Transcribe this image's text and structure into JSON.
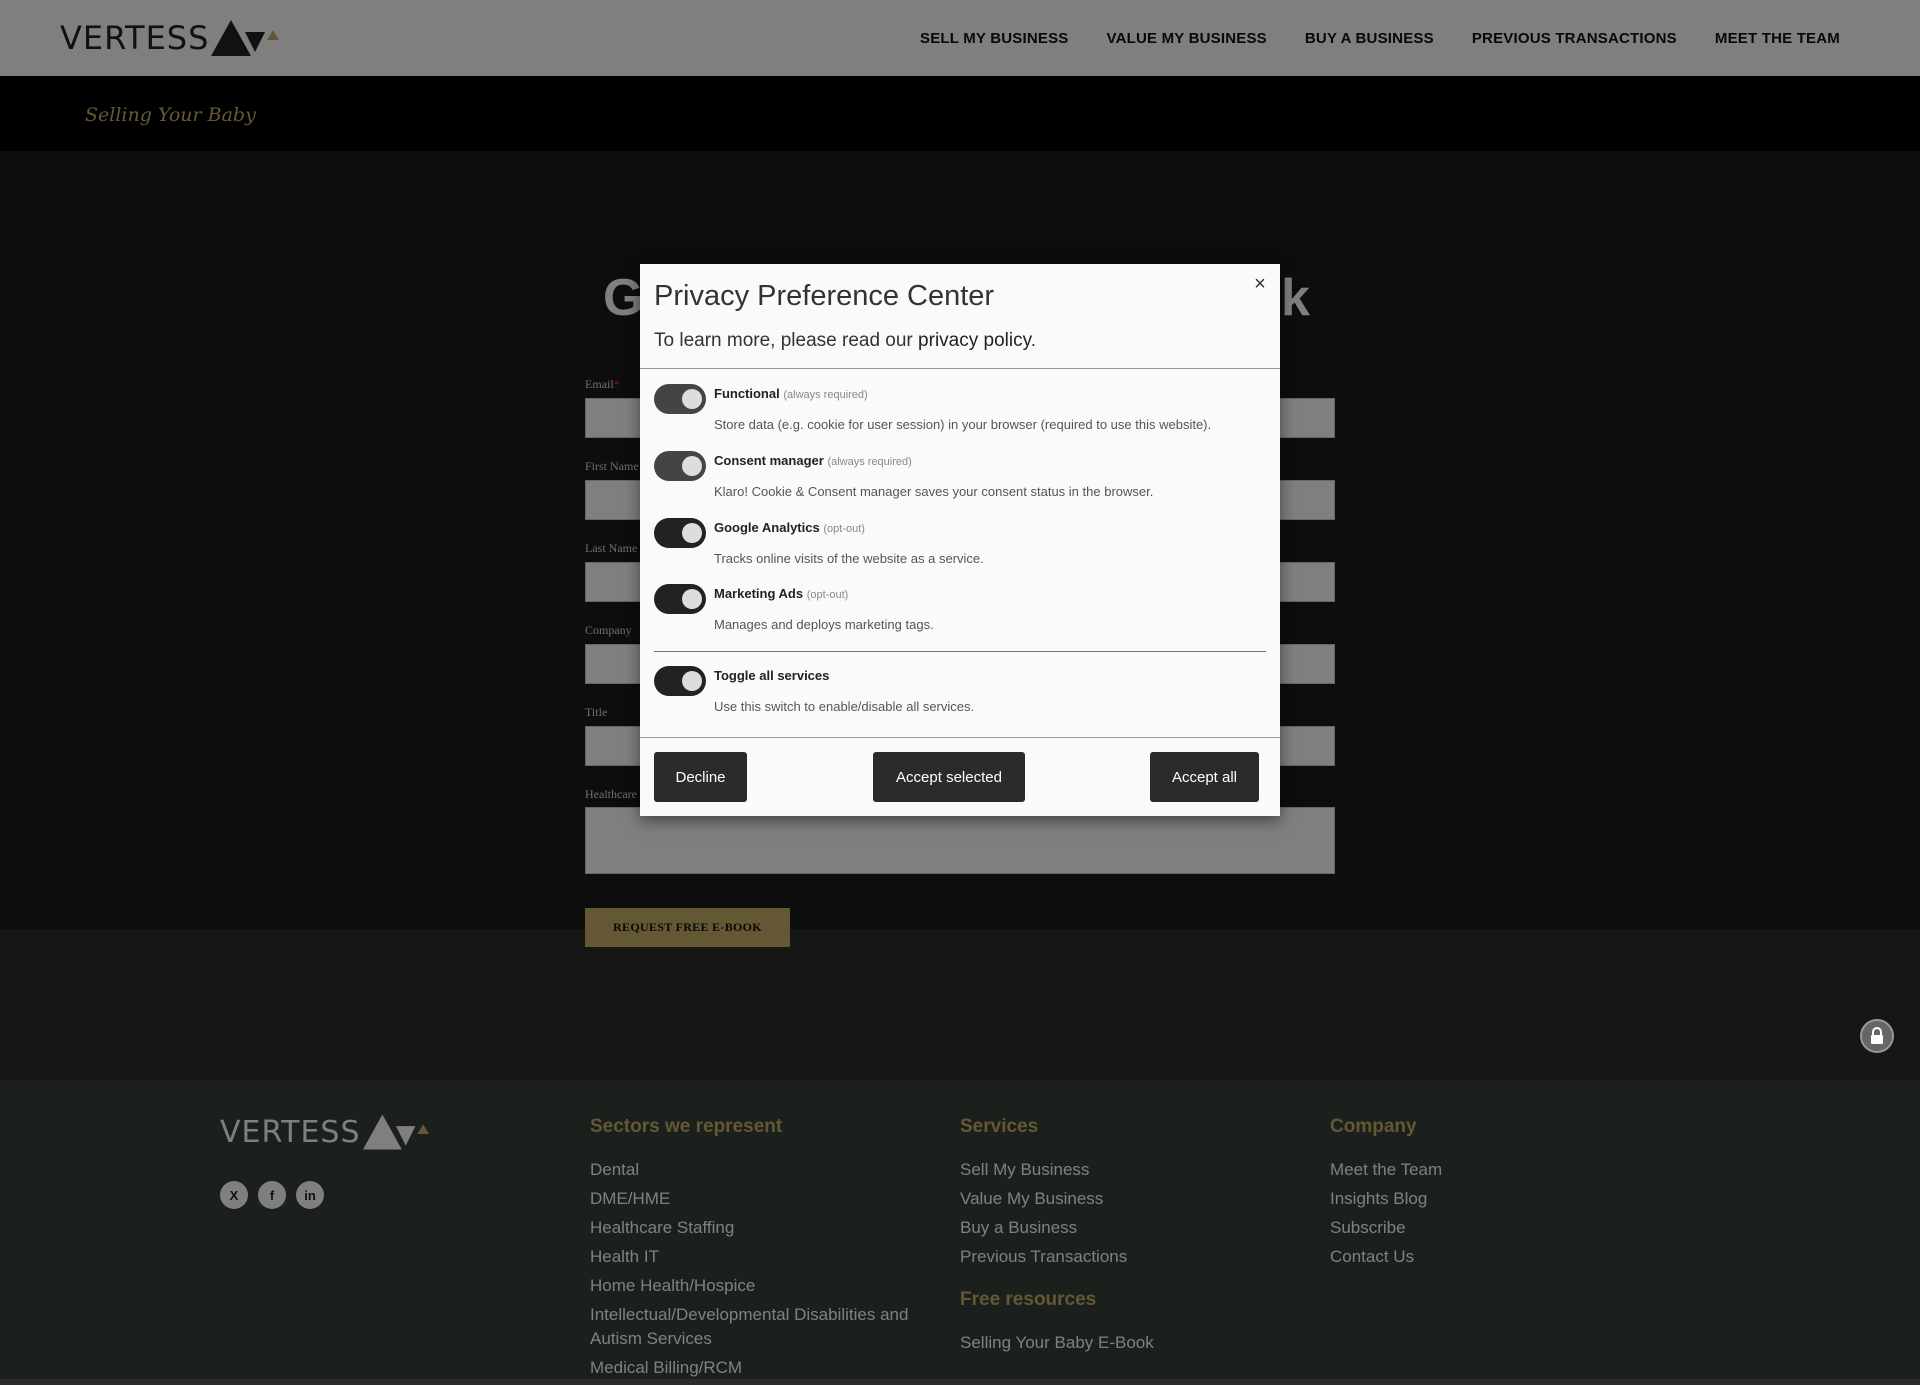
{
  "header": {
    "logo_text": "VERTESS",
    "nav": [
      {
        "label": "SELL MY BUSINESS"
      },
      {
        "label": "VALUE MY BUSINESS"
      },
      {
        "label": "BUY A BUSINESS"
      },
      {
        "label": "PREVIOUS TRANSACTIONS"
      },
      {
        "label": "MEET THE TEAM"
      }
    ]
  },
  "subbar": {
    "title": "Selling Your Baby"
  },
  "hero": {
    "title_left": "G",
    "title_right": "k"
  },
  "form": {
    "email_label": "Email",
    "email_required": "*",
    "first_name_label": "First Name",
    "last_name_label": "Last Name",
    "company_label": "Company",
    "title_label": "Title",
    "healthcare_label": "Healthcare",
    "submit_label": "REQUEST FREE E-BOOK"
  },
  "modal": {
    "title": "Privacy Preference Center",
    "desc_prefix": "To learn more, please read our ",
    "desc_link": "privacy policy",
    "desc_suffix": ".",
    "close_glyph": "×",
    "services": [
      {
        "name": "Functional",
        "tag": "(always required)",
        "desc": "Store data (e.g. cookie for user session) in your browser (required to use this website).",
        "enabled": true
      },
      {
        "name": "Consent manager",
        "tag": "(always required)",
        "desc": "Klaro! Cookie & Consent manager saves your consent status in the browser.",
        "enabled": true
      },
      {
        "name": "Google Analytics",
        "tag": "(opt-out)",
        "desc": "Tracks online visits of the website as a service.",
        "enabled": true
      },
      {
        "name": "Marketing Ads",
        "tag": "(opt-out)",
        "desc": "Manages and deploys marketing tags.",
        "enabled": true
      }
    ],
    "toggle_all": {
      "name": "Toggle all services",
      "desc": "Use this switch to enable/disable all services.",
      "enabled": true
    },
    "buttons": {
      "decline": "Decline",
      "accept_selected": "Accept selected",
      "accept_all": "Accept all"
    }
  },
  "footer": {
    "logo_text": "VERTESS",
    "social": [
      "X",
      "f",
      "in"
    ],
    "sectors": {
      "heading": "Sectors we represent",
      "items": [
        "Dental",
        "DME/HME",
        "Healthcare Staffing",
        "Health IT",
        "Home Health/Hospice",
        "Intellectual/Developmental Disabilities and Autism Services",
        "Medical Billing/RCM"
      ]
    },
    "services": {
      "heading": "Services",
      "items": [
        "Sell My Business",
        "Value My Business",
        "Buy a Business",
        "Previous Transactions"
      ]
    },
    "free_resources": {
      "heading": "Free resources",
      "items": [
        "Selling Your Baby E-Book"
      ]
    },
    "company": {
      "heading": "Company",
      "items": [
        "Meet the Team",
        "Insights Blog",
        "Subscribe",
        "Contact Us"
      ]
    }
  },
  "colors": {
    "accent": "#c9b069",
    "modal_button": "#2b2b2b"
  }
}
